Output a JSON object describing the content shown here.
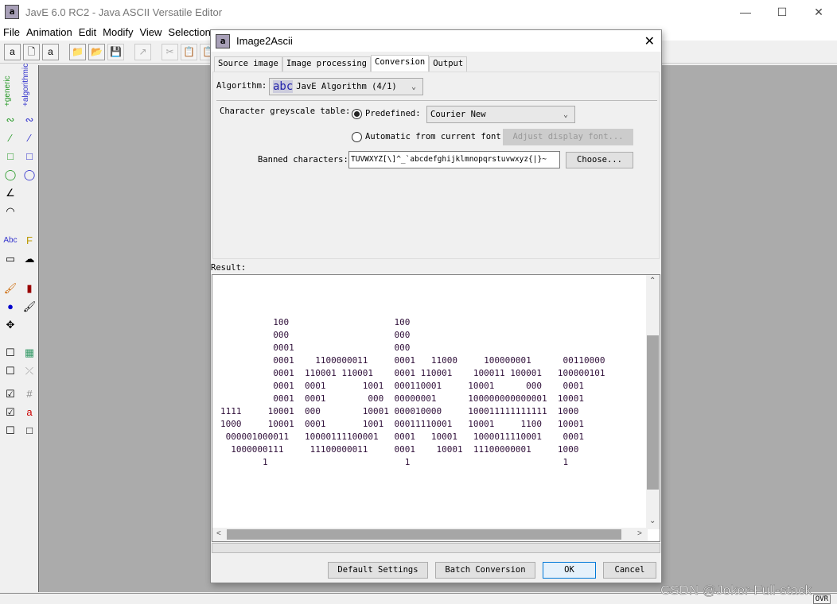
{
  "app": {
    "title": "JavE 6.0 RC2 - Java ASCII Versatile Editor",
    "icon": "jave-logo-icon",
    "window_buttons": [
      "minimize",
      "maximize",
      "close"
    ]
  },
  "menu": [
    "File",
    "Animation",
    "Edit",
    "Modify",
    "View",
    "Selection"
  ],
  "toolbar": [
    "wizard-icon",
    "new-file-icon",
    "animation-icon",
    "tree-icon",
    "open-folder-icon",
    "save-icon",
    "export-icon",
    "cut-icon",
    "copy-icon",
    "paste-icon"
  ],
  "palette": {
    "label_generic": "+generic",
    "label_algorithmic": "+algorithmic",
    "generic_color": "#2a9a2a",
    "algorithmic_color": "#3333cc"
  },
  "dialog": {
    "title": "Image2Ascii",
    "tabs": [
      "Source image",
      "Image processing",
      "Conversion",
      "Output"
    ],
    "active_tab": "Conversion",
    "algorithm_label": "Algorithm:",
    "algorithm_value": "JavE Algorithm (4/1)",
    "algorithm_icon_text": "abc",
    "greyscale_label": "Character greyscale table:",
    "predefined_label": "Predefined:",
    "predefined_value": "Courier New",
    "predefined_selected": true,
    "automatic_label": "Automatic from current font",
    "adjust_button": "Adjust display font...",
    "banned_label": "Banned characters:",
    "banned_value": "TUVWXYZ[\\]^_`abcdefghijklmnopqrstuvwxyz{|}~",
    "choose_button": "Choose...",
    "result_label": "Result:",
    "result_lines": [
      "          100                    100",
      "          000                    000",
      "          0001                   000",
      "          0001    1100000011     0001   11000     100000001      00110000",
      "          0001  110001 110001    0001 110001    100011 100001   100000101",
      "          0001  0001       1001  000110001     10001      000    0001",
      "          0001  0001        000  00000001      100000000000001  10001",
      "1111     10001  000        10001 000010000     100011111111111  1000",
      "1000     10001  0001       1001  00011110001   10001     1100   10001",
      " 000001000011   10000111100001   0001   10001   1000011110001    0001",
      "  1000000111     11100000011     0001    10001  11100000001     1000",
      "        1                          1                             1"
    ],
    "buttons": {
      "default": "Default Settings",
      "batch": "Batch Conversion",
      "ok": "OK",
      "cancel": "Cancel"
    }
  },
  "status": {
    "mode": "OVR"
  },
  "watermark": "CSDN @Joker-Full-stack"
}
